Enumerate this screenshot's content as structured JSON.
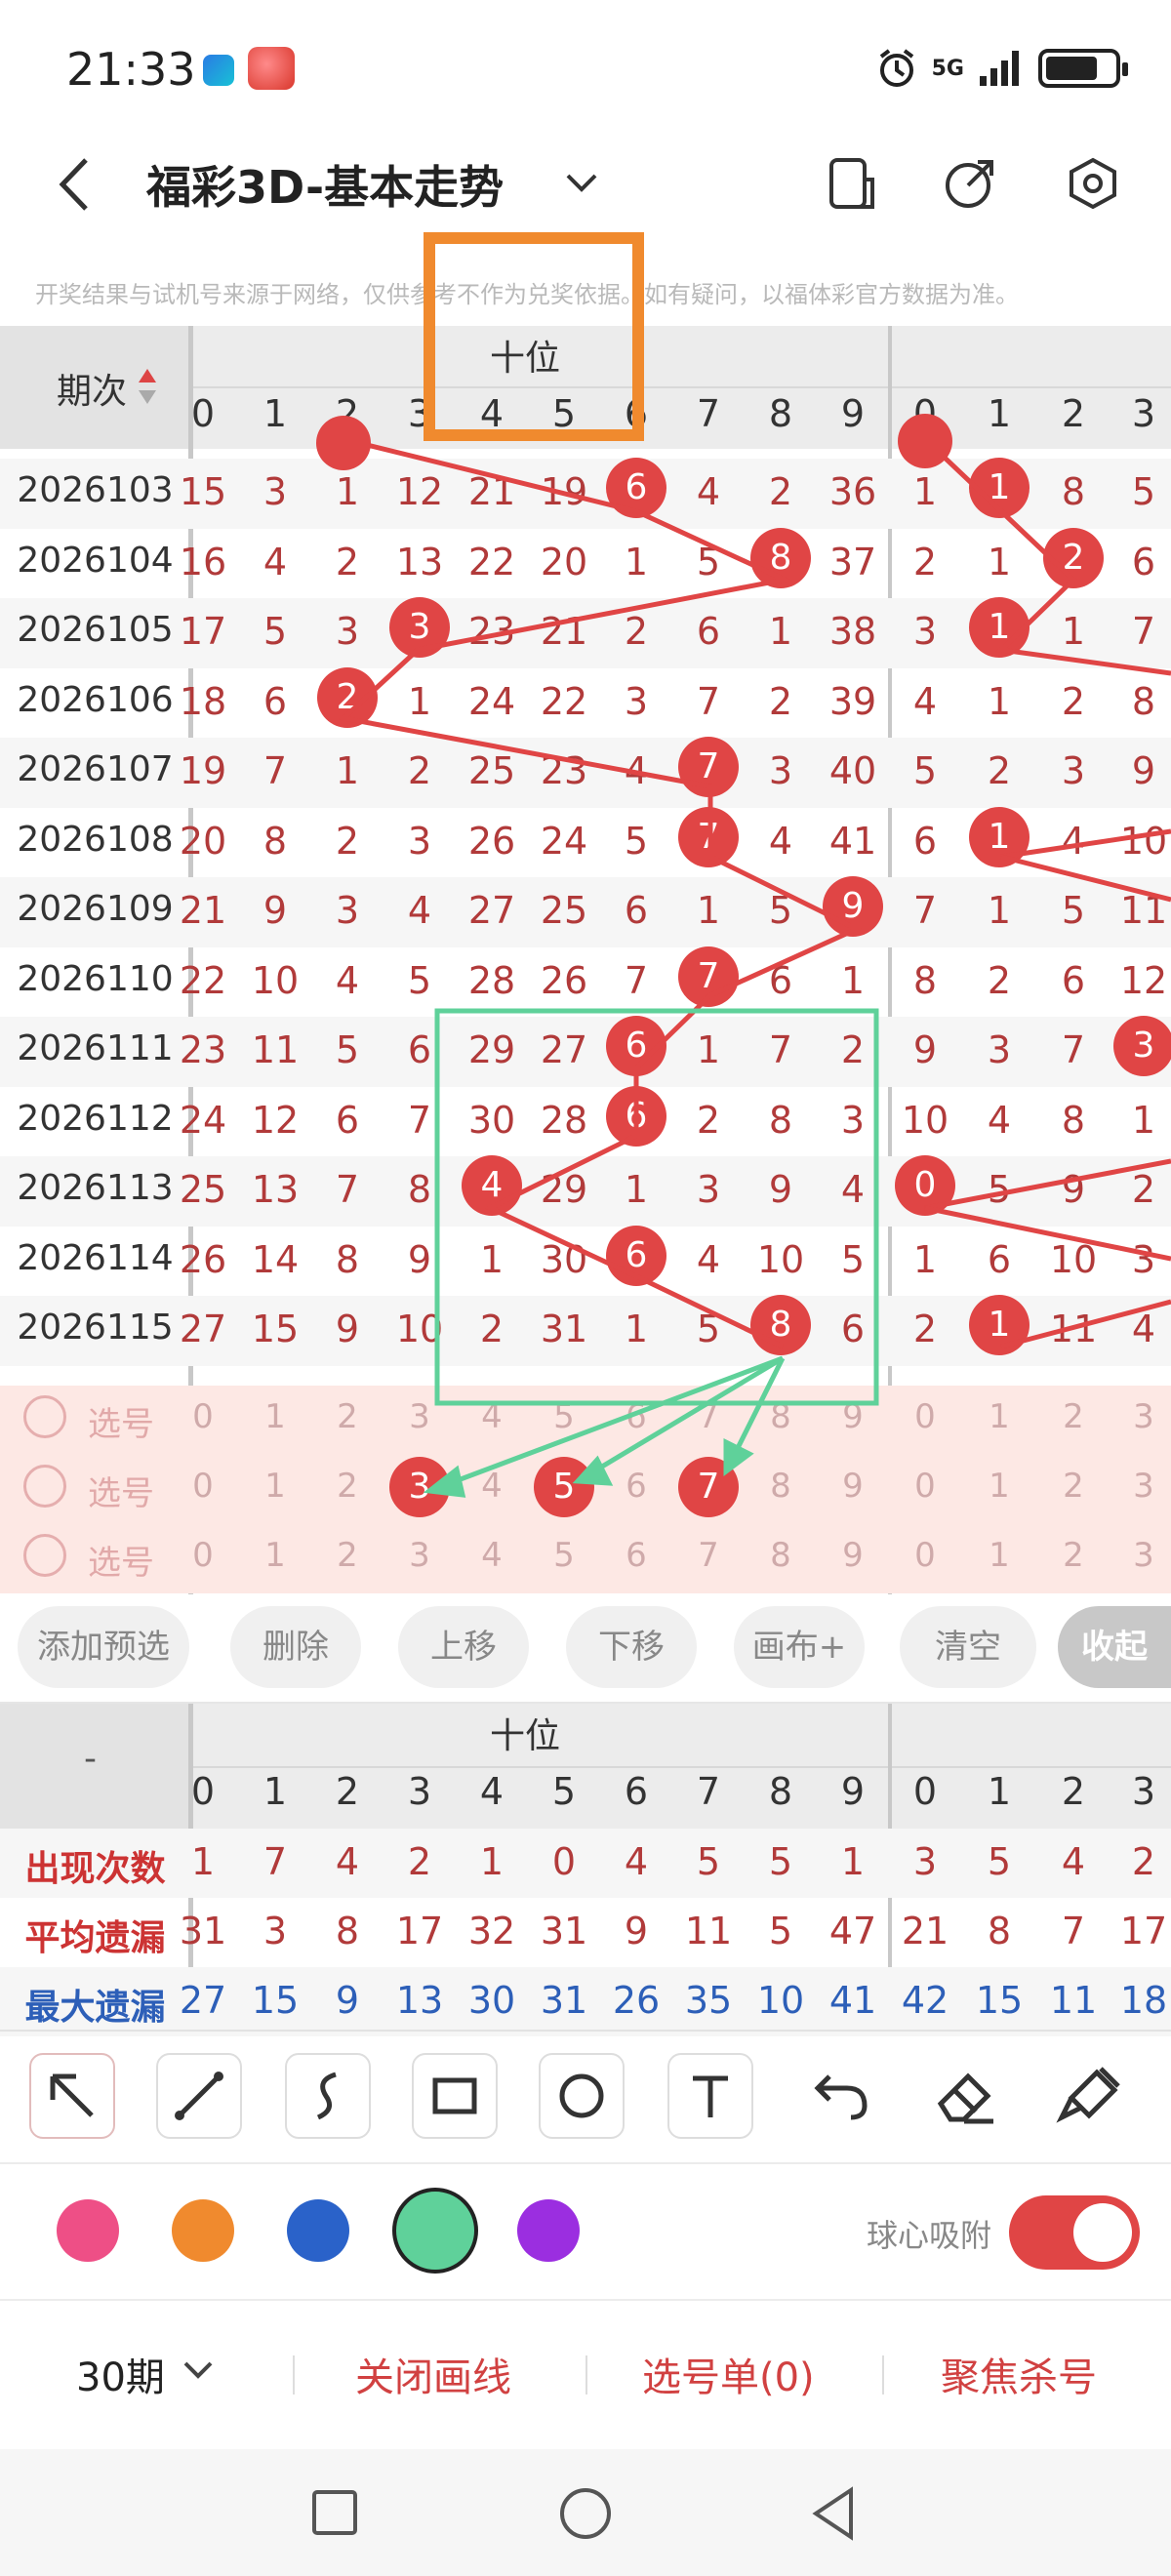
{
  "status": {
    "time": "21:33",
    "network": "5G"
  },
  "header": {
    "title": "福彩3D-基本走势"
  },
  "notice": "开奖结果与试机号来源于网络，仅供参考不作为兑奖依据。如有疑问，以福体彩官方数据为准。",
  "chart": {
    "period_header": "期次",
    "section_label": "十位",
    "col_headers_a": [
      "0",
      "1",
      "2",
      "3",
      "4",
      "5",
      "6",
      "7",
      "8",
      "9"
    ],
    "col_headers_b": [
      "0",
      "1",
      "2",
      "3"
    ],
    "rows": [
      {
        "period": "2026103",
        "a": [
          "15",
          "3",
          "1",
          "12",
          "21",
          "19",
          "6",
          "4",
          "2",
          "36"
        ],
        "b": [
          "1",
          "1",
          "8",
          "5"
        ]
      },
      {
        "period": "2026104",
        "a": [
          "16",
          "4",
          "2",
          "13",
          "22",
          "20",
          "1",
          "5",
          "8",
          "37"
        ],
        "b": [
          "2",
          "1",
          "2",
          "6"
        ]
      },
      {
        "period": "2026105",
        "a": [
          "17",
          "5",
          "3",
          "3",
          "23",
          "21",
          "2",
          "6",
          "1",
          "38"
        ],
        "b": [
          "3",
          "1",
          "1",
          "7"
        ]
      },
      {
        "period": "2026106",
        "a": [
          "18",
          "6",
          "2",
          "1",
          "24",
          "22",
          "3",
          "7",
          "2",
          "39"
        ],
        "b": [
          "4",
          "1",
          "2",
          "8"
        ]
      },
      {
        "period": "2026107",
        "a": [
          "19",
          "7",
          "1",
          "2",
          "25",
          "23",
          "4",
          "7",
          "3",
          "40"
        ],
        "b": [
          "5",
          "2",
          "3",
          "9"
        ]
      },
      {
        "period": "2026108",
        "a": [
          "20",
          "8",
          "2",
          "3",
          "26",
          "24",
          "5",
          "7",
          "4",
          "41"
        ],
        "b": [
          "6",
          "1",
          "4",
          "10"
        ]
      },
      {
        "period": "2026109",
        "a": [
          "21",
          "9",
          "3",
          "4",
          "27",
          "25",
          "6",
          "1",
          "5",
          "9"
        ],
        "b": [
          "7",
          "1",
          "5",
          "11"
        ]
      },
      {
        "period": "2026110",
        "a": [
          "22",
          "10",
          "4",
          "5",
          "28",
          "26",
          "7",
          "7",
          "6",
          "1"
        ],
        "b": [
          "8",
          "2",
          "6",
          "12"
        ]
      },
      {
        "period": "2026111",
        "a": [
          "23",
          "11",
          "5",
          "6",
          "29",
          "27",
          "6",
          "1",
          "7",
          "2"
        ],
        "b": [
          "9",
          "3",
          "7",
          "3"
        ]
      },
      {
        "period": "2026112",
        "a": [
          "24",
          "12",
          "6",
          "7",
          "30",
          "28",
          "6",
          "2",
          "8",
          "3"
        ],
        "b": [
          "10",
          "4",
          "8",
          "1"
        ]
      },
      {
        "period": "2026113",
        "a": [
          "25",
          "13",
          "7",
          "8",
          "4",
          "29",
          "1",
          "3",
          "9",
          "4"
        ],
        "b": [
          "0",
          "5",
          "9",
          "2"
        ]
      },
      {
        "period": "2026114",
        "a": [
          "26",
          "14",
          "8",
          "9",
          "1",
          "30",
          "6",
          "4",
          "10",
          "5"
        ],
        "b": [
          "1",
          "6",
          "10",
          "3"
        ]
      },
      {
        "period": "2026115",
        "a": [
          "27",
          "15",
          "9",
          "10",
          "2",
          "31",
          "1",
          "5",
          "8",
          "6"
        ],
        "b": [
          "2",
          "1",
          "11",
          "4"
        ]
      }
    ],
    "select_label": "选号",
    "select_digits_a": [
      "0",
      "1",
      "2",
      "3",
      "4",
      "5",
      "6",
      "7",
      "8",
      "9"
    ],
    "select_digits_b": [
      "0",
      "1",
      "2",
      "3"
    ]
  },
  "actions": [
    "添加预选",
    "删除",
    "上移",
    "下移",
    "画布+",
    "清空",
    "收起"
  ],
  "stats": {
    "dash": "-",
    "section_label": "十位",
    "rows": [
      {
        "label": "出现次数",
        "a": [
          "1",
          "7",
          "4",
          "2",
          "1",
          "0",
          "4",
          "5",
          "5",
          "1"
        ],
        "b": [
          "3",
          "5",
          "4",
          "2"
        ]
      },
      {
        "label": "平均遗漏",
        "a": [
          "31",
          "3",
          "8",
          "17",
          "32",
          "31",
          "9",
          "11",
          "5",
          "47"
        ],
        "b": [
          "21",
          "8",
          "7",
          "17"
        ]
      },
      {
        "label": "最大遗漏",
        "a": [
          "27",
          "15",
          "9",
          "13",
          "30",
          "31",
          "26",
          "35",
          "10",
          "41"
        ],
        "b": [
          "42",
          "15",
          "11",
          "18"
        ]
      }
    ]
  },
  "tools": [
    "pointer",
    "line",
    "curve",
    "rectangle",
    "circle",
    "text",
    "undo",
    "eraser",
    "clear-brush"
  ],
  "palette": {
    "colors": [
      "#ee4f86",
      "#f08a2e",
      "#2a62c9",
      "#5fd19a",
      "#9b2ee0"
    ],
    "selected_index": 3
  },
  "snap": {
    "label": "球心吸附",
    "on": true
  },
  "bottom": {
    "period_select": "30期",
    "close_draw": "关闭画线",
    "pick_list": "选号单(0)",
    "focus_kill": "聚焦杀号"
  }
}
